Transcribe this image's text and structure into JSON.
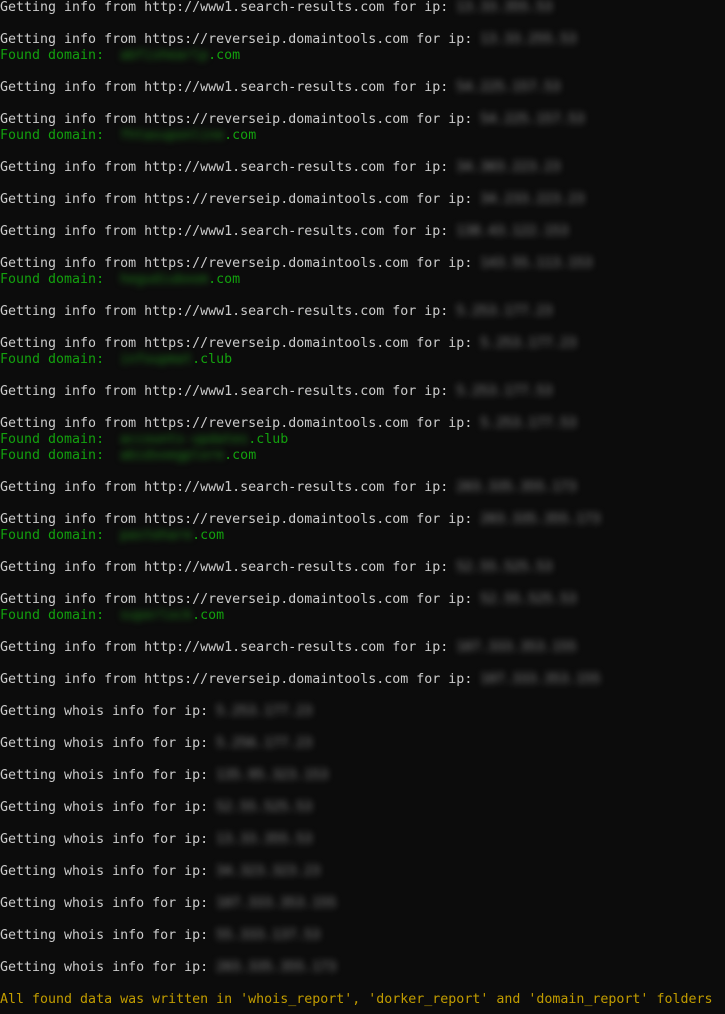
{
  "terminal": {
    "lines": [
      {
        "kind": "info",
        "prefix": "Getting info from http://www1.search-results.com for ip: ",
        "redacted": "13.33.355.53"
      },
      {
        "kind": "blank"
      },
      {
        "kind": "info",
        "prefix": "Getting info from https://reverseip.domaintools.com for ip: ",
        "redacted": "13.33.255.53"
      },
      {
        "kind": "found",
        "prefix": "Found domain:  ",
        "redacted": "abfishearlp",
        "suffix": ".com"
      },
      {
        "kind": "blank"
      },
      {
        "kind": "info",
        "prefix": "Getting info from http://www1.search-results.com for ip: ",
        "redacted": "54.225.157.53"
      },
      {
        "kind": "blank"
      },
      {
        "kind": "info",
        "prefix": "Getting info from https://reverseip.domaintools.com for ip: ",
        "redacted": "54.225.157.53"
      },
      {
        "kind": "found",
        "prefix": "Found domain:  ",
        "redacted": "fhtasuponline",
        "suffix": ".com"
      },
      {
        "kind": "blank"
      },
      {
        "kind": "info",
        "prefix": "Getting info from http://www1.search-results.com for ip: ",
        "redacted": "34.303.223.23"
      },
      {
        "kind": "blank"
      },
      {
        "kind": "info",
        "prefix": "Getting info from https://reverseip.domaintools.com for ip: ",
        "redacted": "34.233.223.23"
      },
      {
        "kind": "blank"
      },
      {
        "kind": "info",
        "prefix": "Getting info from http://www1.search-results.com for ip: ",
        "redacted": "138.43.122.153"
      },
      {
        "kind": "blank"
      },
      {
        "kind": "info",
        "prefix": "Getting info from https://reverseip.domaintools.com for ip: ",
        "redacted": "143.55.113.153"
      },
      {
        "kind": "found",
        "prefix": "Found domain:  ",
        "redacted": "hegudiuboom",
        "suffix": ".com"
      },
      {
        "kind": "blank"
      },
      {
        "kind": "info",
        "prefix": "Getting info from http://www1.search-results.com for ip: ",
        "redacted": "5.253.177.23"
      },
      {
        "kind": "blank"
      },
      {
        "kind": "info",
        "prefix": "Getting info from https://reverseip.domaintools.com for ip: ",
        "redacted": "5.253.177.23"
      },
      {
        "kind": "found",
        "prefix": "Found domain:  ",
        "redacted": "infoupmat",
        "suffix": ".club"
      },
      {
        "kind": "blank"
      },
      {
        "kind": "info",
        "prefix": "Getting info from http://www1.search-results.com for ip: ",
        "redacted": "5.253.177.53"
      },
      {
        "kind": "blank"
      },
      {
        "kind": "info",
        "prefix": "Getting info from https://reverseip.domaintools.com for ip: ",
        "redacted": "5.253.177.53"
      },
      {
        "kind": "found",
        "prefix": "Found domain:  ",
        "redacted": "accounts-updates",
        "suffix": ".club"
      },
      {
        "kind": "found",
        "prefix": "Found domain:  ",
        "redacted": "abidsoegplore",
        "suffix": ".com"
      },
      {
        "kind": "blank"
      },
      {
        "kind": "info",
        "prefix": "Getting info from http://www1.search-results.com for ip: ",
        "redacted": "203.335.355.173"
      },
      {
        "kind": "blank"
      },
      {
        "kind": "info",
        "prefix": "Getting info from https://reverseip.domaintools.com for ip: ",
        "redacted": "203.335.355.173"
      },
      {
        "kind": "found",
        "prefix": "Found domain:  ",
        "redacted": "pastehare",
        "suffix": ".com"
      },
      {
        "kind": "blank"
      },
      {
        "kind": "info",
        "prefix": "Getting info from http://www1.search-results.com for ip: ",
        "redacted": "52.55.525.53"
      },
      {
        "kind": "blank"
      },
      {
        "kind": "info",
        "prefix": "Getting info from https://reverseip.domaintools.com for ip: ",
        "redacted": "52.55.525.53"
      },
      {
        "kind": "found",
        "prefix": "Found domain:  ",
        "redacted": "superlock",
        "suffix": ".com"
      },
      {
        "kind": "blank"
      },
      {
        "kind": "info",
        "prefix": "Getting info from http://www1.search-results.com for ip: ",
        "redacted": "107.333.353.155"
      },
      {
        "kind": "blank"
      },
      {
        "kind": "info",
        "prefix": "Getting info from https://reverseip.domaintools.com for ip: ",
        "redacted": "107.333.353.155"
      },
      {
        "kind": "blank"
      },
      {
        "kind": "info",
        "prefix": "Getting whois info for ip: ",
        "redacted": "5.253.177.23"
      },
      {
        "kind": "blank"
      },
      {
        "kind": "info",
        "prefix": "Getting whois info for ip: ",
        "redacted": "5.256.177.23"
      },
      {
        "kind": "blank"
      },
      {
        "kind": "info",
        "prefix": "Getting whois info for ip: ",
        "redacted": "135.95.323.153"
      },
      {
        "kind": "blank"
      },
      {
        "kind": "info",
        "prefix": "Getting whois info for ip: ",
        "redacted": "52.55.525.53"
      },
      {
        "kind": "blank"
      },
      {
        "kind": "info",
        "prefix": "Getting whois info for ip: ",
        "redacted": "13.33.355.53"
      },
      {
        "kind": "blank"
      },
      {
        "kind": "info",
        "prefix": "Getting whois info for ip: ",
        "redacted": "34.323.323.23"
      },
      {
        "kind": "blank"
      },
      {
        "kind": "info",
        "prefix": "Getting whois info for ip: ",
        "redacted": "107.333.353.155"
      },
      {
        "kind": "blank"
      },
      {
        "kind": "info",
        "prefix": "Getting whois info for ip: ",
        "redacted": "55.333.137.53"
      },
      {
        "kind": "blank"
      },
      {
        "kind": "info",
        "prefix": "Getting whois info for ip: ",
        "redacted": "203.335.355.173"
      },
      {
        "kind": "blank"
      },
      {
        "kind": "final",
        "text": "All found data was written in 'whois_report', 'dorker_report' and 'domain_report' folders"
      }
    ]
  },
  "colors": {
    "background": "#0c0c0c",
    "text": "#cccccc",
    "found": "#13a10e",
    "final": "#c19c00"
  }
}
